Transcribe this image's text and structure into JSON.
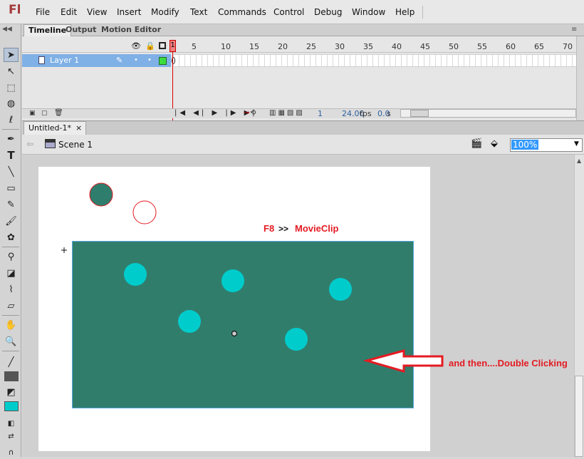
{
  "app": {
    "logo": "Fl"
  },
  "menu": [
    "File",
    "Edit",
    "View",
    "Insert",
    "Modify",
    "Text",
    "Commands",
    "Control",
    "Debug",
    "Window",
    "Help"
  ],
  "panel_tabs": [
    "Timeline",
    "Output",
    "Motion Editor"
  ],
  "timeline": {
    "ruler": [
      "1",
      "5",
      "10",
      "15",
      "20",
      "25",
      "30",
      "35",
      "40",
      "45",
      "50",
      "55",
      "60",
      "65",
      "70"
    ],
    "layer_name": "Layer 1",
    "current_frame": "1",
    "fps": "24.00",
    "fps_unit": "fps",
    "time": "0.0",
    "time_unit": "s"
  },
  "document": {
    "tab_title": "Untitled-1*",
    "tab_close": "×",
    "scene_name": "Scene 1",
    "zoom": "100%"
  },
  "annotations": {
    "f8_key": "F8",
    "arrows": ">>",
    "movieclip": "MovieClip",
    "double_click": "and then....Double Clicking"
  },
  "colors": {
    "stage_rect_fill": "#317d6c",
    "circle_fill": "#00cccc",
    "ref_circle_fill": "#2f7d6c",
    "ref_circle_stroke": "#e41b23",
    "annotation_red": "#e41b23",
    "fill_swatch": "#00cccc",
    "stroke_swatch": "#555555"
  },
  "icons": {
    "tools": [
      "selection-tool-icon",
      "subselection-tool-icon",
      "free-transform-tool-icon",
      "3d-rotation-tool-icon",
      "lasso-tool-icon",
      "pen-tool-icon",
      "text-tool-icon",
      "line-tool-icon",
      "rectangle-tool-icon",
      "pencil-tool-icon",
      "brush-tool-icon",
      "deco-tool-icon",
      "bone-tool-icon",
      "paint-bucket-tool-icon",
      "eyedropper-tool-icon",
      "eraser-tool-icon",
      "hand-tool-icon",
      "zoom-tool-icon"
    ]
  }
}
